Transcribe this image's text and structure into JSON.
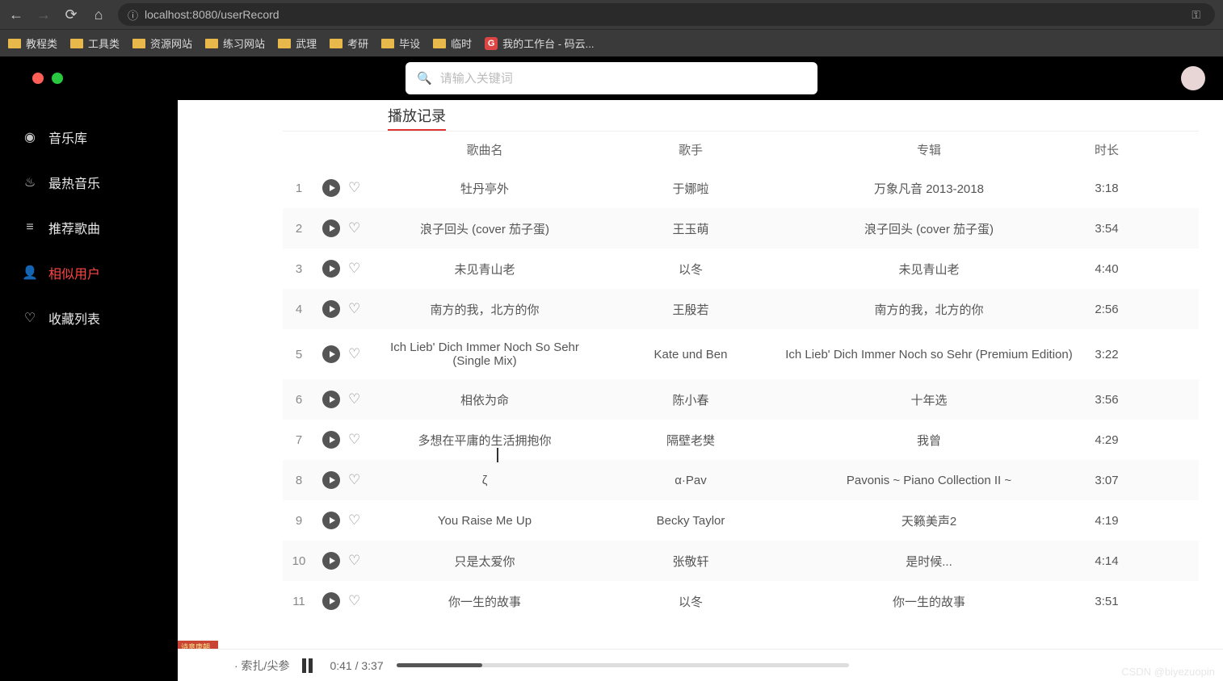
{
  "browser": {
    "url": "localhost:8080/userRecord",
    "bookmarks": [
      "教程类",
      "工具类",
      "资源网站",
      "练习网站",
      "武理",
      "考研",
      "毕设",
      "临时"
    ],
    "bookmark_link": "我的工作台 - 码云..."
  },
  "search": {
    "placeholder": "请输入关键词"
  },
  "sidebar": {
    "items": [
      {
        "label": "音乐库",
        "icon": "disc"
      },
      {
        "label": "最热音乐",
        "icon": "fire"
      },
      {
        "label": "推荐歌曲",
        "icon": "list"
      },
      {
        "label": "相似用户",
        "icon": "user",
        "active": true
      },
      {
        "label": "收藏列表",
        "icon": "heart"
      }
    ]
  },
  "page": {
    "title": "播放记录"
  },
  "table": {
    "headers": {
      "name": "歌曲名",
      "artist": "歌手",
      "album": "专辑",
      "duration": "时长"
    },
    "rows": [
      {
        "idx": "1",
        "name": "牡丹亭外",
        "artist": "于娜啦",
        "album": "万象凡音 2013-2018",
        "duration": "3:18"
      },
      {
        "idx": "2",
        "name": "浪子回头 (cover 茄子蛋)",
        "artist": "王玉萌",
        "album": "浪子回头 (cover 茄子蛋)",
        "duration": "3:54"
      },
      {
        "idx": "3",
        "name": "未见青山老",
        "artist": "以冬",
        "album": "未见青山老",
        "duration": "4:40"
      },
      {
        "idx": "4",
        "name": "南方的我，北方的你",
        "artist": "王殷若",
        "album": "南方的我，北方的你",
        "duration": "2:56"
      },
      {
        "idx": "5",
        "name": "Ich Lieb' Dich Immer Noch So Sehr (Single Mix)",
        "artist": "Kate und Ben",
        "album": "Ich Lieb' Dich Immer Noch so Sehr (Premium Edition)",
        "duration": "3:22"
      },
      {
        "idx": "6",
        "name": "相依为命",
        "artist": "陈小春",
        "album": "十年选",
        "duration": "3:56"
      },
      {
        "idx": "7",
        "name": "多想在平庸的生活拥抱你",
        "artist": "隔壁老樊",
        "album": "我曾",
        "duration": "4:29"
      },
      {
        "idx": "8",
        "name": "ζ",
        "artist": "α·Pav",
        "album": "Pavonis ~ Piano Collection II ~",
        "duration": "3:07"
      },
      {
        "idx": "9",
        "name": "You Raise Me Up",
        "artist": "Becky Taylor",
        "album": "天籁美声2",
        "duration": "4:19"
      },
      {
        "idx": "10",
        "name": "只是太爱你",
        "artist": "张敬轩",
        "album": "是时候...",
        "duration": "4:14"
      },
      {
        "idx": "11",
        "name": "你一生的故事",
        "artist": "以冬",
        "album": "你一生的故事",
        "duration": "3:51"
      }
    ]
  },
  "player": {
    "track": "· 索扎/尖参",
    "time": "0:41 / 3:37",
    "cover_text": "诗意唐朝中国"
  },
  "watermark": "CSDN @biyezuopin"
}
